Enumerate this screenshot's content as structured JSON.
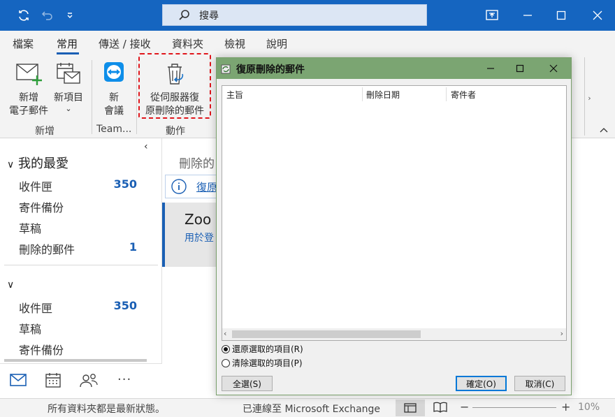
{
  "search": {
    "placeholder": "搜尋"
  },
  "tabs": [
    "檔案",
    "常用",
    "傳送 / 接收",
    "資料夾",
    "檢視",
    "說明"
  ],
  "ribbon": {
    "new_email": [
      "新增",
      "電子郵件"
    ],
    "new_items": [
      "新項目",
      "⌄"
    ],
    "new_meeting": [
      "新",
      "會議"
    ],
    "recover": [
      "從伺服器復",
      "原刪除的郵件"
    ],
    "groups": {
      "new": "新增",
      "teams": "Team...",
      "actions": "動作"
    }
  },
  "nav": {
    "favorites_header": "我的最愛",
    "favorites": [
      {
        "label": "收件匣",
        "count": "350"
      },
      {
        "label": "寄件備份",
        "count": ""
      },
      {
        "label": "草稿",
        "count": ""
      },
      {
        "label": "刪除的郵件",
        "count": "1"
      }
    ],
    "account": [
      {
        "label": "收件匣",
        "count": "350"
      },
      {
        "label": "草稿",
        "count": ""
      },
      {
        "label": "寄件備份",
        "count": ""
      }
    ]
  },
  "list": {
    "title": "刪除的",
    "info_link": "復原",
    "item_title": "Zoo",
    "item_sub": "用於登"
  },
  "dialog": {
    "title": "復原刪除的郵件",
    "columns": [
      "主旨",
      "刪除日期",
      "寄件者"
    ],
    "radio_restore": "還原選取的項目(R)",
    "radio_purge": "清除選取的項目(P)",
    "select_all": "全選(S)",
    "ok": "確定(O)",
    "cancel": "取消(C)"
  },
  "status": {
    "left": "所有資料夾都是最新狀態。",
    "center": "已連線至 Microsoft Exchange",
    "zoom": "10%"
  },
  "colors": {
    "titlebar": "#1565c0",
    "accent": "#1a5fb4",
    "dialog_title": "#7ba572",
    "highlight": "#e0161c"
  }
}
